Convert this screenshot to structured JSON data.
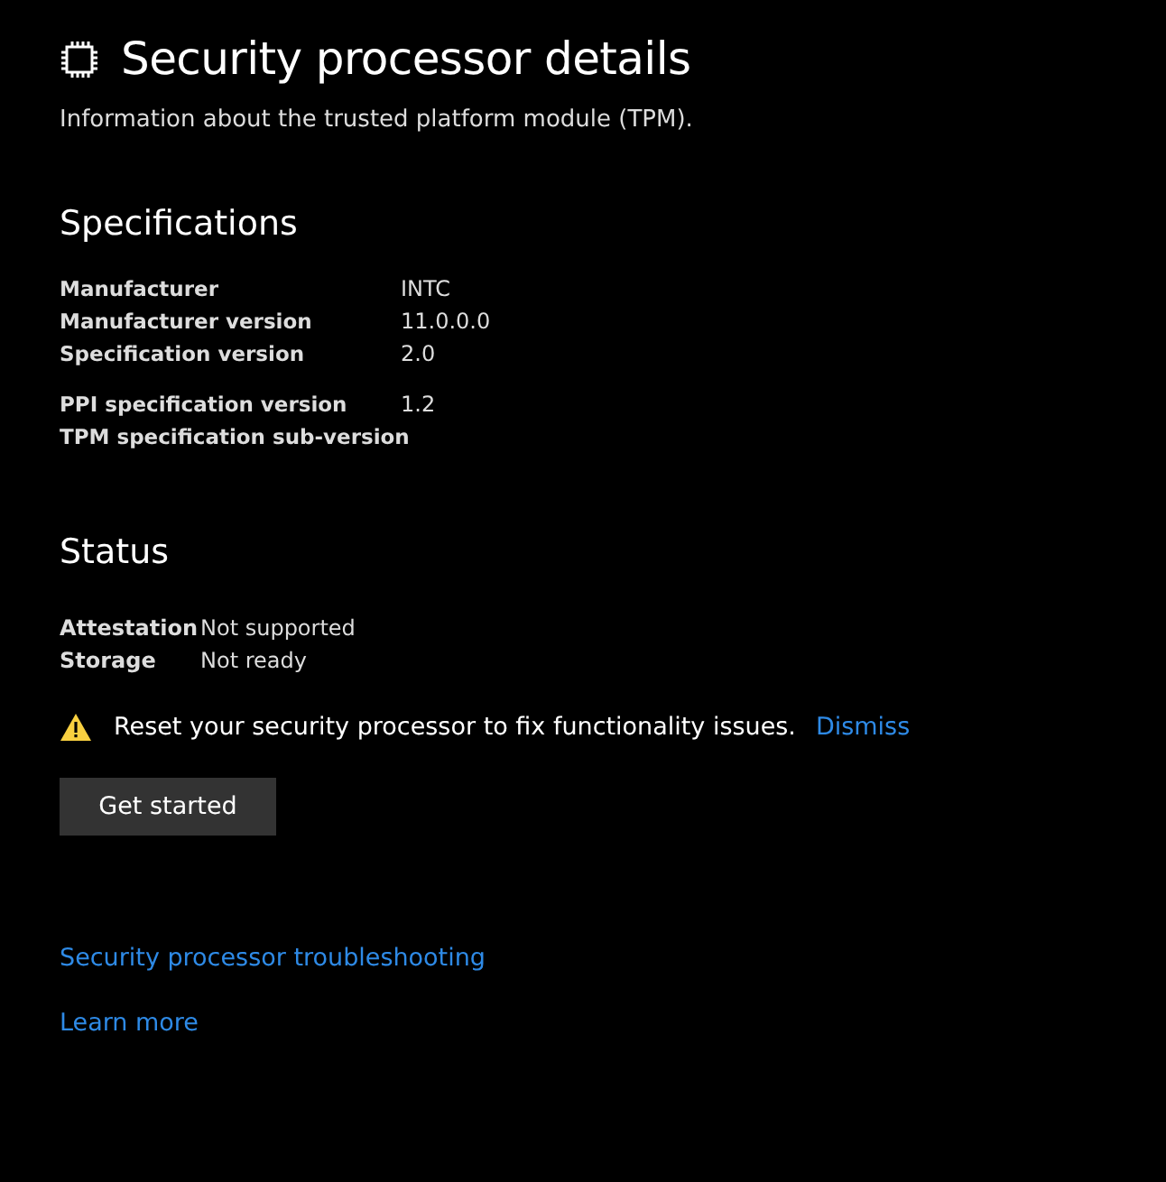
{
  "title": "Security processor details",
  "subtitle": "Information about the trusted platform module (TPM).",
  "specifications": {
    "heading": "Specifications",
    "groups": [
      {
        "rows": [
          {
            "label": "Manufacturer",
            "value": "INTC"
          },
          {
            "label": "Manufacturer version",
            "value": "11.0.0.0"
          },
          {
            "label": "Specification version",
            "value": "2.0"
          }
        ]
      },
      {
        "rows": [
          {
            "label": "PPI specification version",
            "value": "1.2"
          },
          {
            "label": "TPM specification sub-version"
          }
        ]
      }
    ]
  },
  "status": {
    "heading": "Status",
    "rows": [
      {
        "label": "Attestation",
        "value": "Not supported"
      },
      {
        "label": "Storage",
        "value": "Not ready"
      }
    ],
    "warning": {
      "message": "Reset your security processor to fix functionality issues.",
      "link": "Dismiss"
    },
    "button": "Get started"
  },
  "links": [
    "Security processor troubleshooting",
    "Learn more"
  ]
}
